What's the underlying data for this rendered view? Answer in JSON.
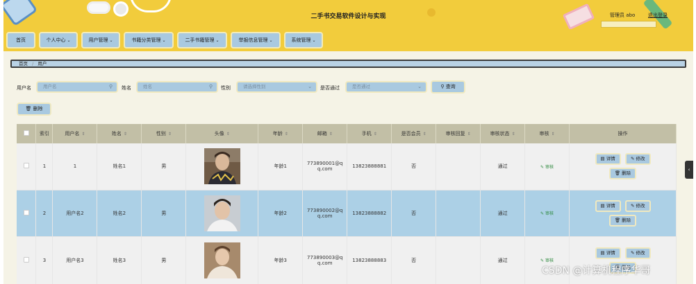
{
  "header": {
    "app_title": "二手书交易软件设计与实现",
    "user_info": "管理员 abo",
    "logout_label": "退出登录"
  },
  "nav": {
    "items": [
      {
        "label": "首页",
        "chevron": false
      },
      {
        "label": "个人中心",
        "chevron": true
      },
      {
        "label": "用户管理",
        "chevron": true
      },
      {
        "label": "书籍分类管理",
        "chevron": true
      },
      {
        "label": "二手书籍管理",
        "chevron": true
      },
      {
        "label": "举报信息管理",
        "chevron": true
      },
      {
        "label": "系统管理",
        "chevron": true
      }
    ]
  },
  "breadcrumb": {
    "home": "首页",
    "sep": "/",
    "current": "用户"
  },
  "search": {
    "username_label": "用户名",
    "username_placeholder": "用户名",
    "name_label": "姓名",
    "name_placeholder": "姓名",
    "gender_label": "性别",
    "gender_placeholder": "请选择性别",
    "approved_label": "是否通过",
    "approved_placeholder": "是否通过",
    "search_button": "查询",
    "delete_button": "删除"
  },
  "table": {
    "headers": [
      "索引",
      "用户名",
      "姓名",
      "性别",
      "头像",
      "年龄",
      "邮箱",
      "手机",
      "是否会员",
      "审核回复",
      "审核状态",
      "审核",
      "操作"
    ],
    "rows": [
      {
        "index": "1",
        "username": "1",
        "name": "姓名1",
        "gender": "男",
        "age": "年龄1",
        "email": "773890001@q.com",
        "email_line1": "773890001@q",
        "email_line2": "q.com",
        "phone": "13823888881",
        "member": "否",
        "reply": "",
        "status": "通过",
        "audit_label": "审核"
      },
      {
        "index": "2",
        "username": "用户名2",
        "name": "姓名2",
        "gender": "男",
        "age": "年龄2",
        "email": "773890002@q.com",
        "email_line1": "773890002@q",
        "email_line2": "q.com",
        "phone": "13823888882",
        "member": "否",
        "reply": "",
        "status": "通过",
        "audit_label": "审核"
      },
      {
        "index": "3",
        "username": "用户名3",
        "name": "姓名3",
        "gender": "男",
        "age": "年龄3",
        "email": "773890003@q.com",
        "email_line1": "773890003@q",
        "email_line2": "q.com",
        "phone": "13823888883",
        "member": "否",
        "reply": "",
        "status": "通过",
        "audit_label": "审核"
      }
    ],
    "actions": {
      "detail": "详情",
      "edit": "修改",
      "delete": "删除"
    }
  },
  "side_toggle": "‹",
  "watermark": "CSDN @计算机程序华哥",
  "colors": {
    "header_bg": "#f2cc3c",
    "button_bg": "#a9c9e0",
    "page_bg": "#f5f3e6",
    "row_highlight": "#acd0e6",
    "table_header": "#c2bfa6"
  }
}
